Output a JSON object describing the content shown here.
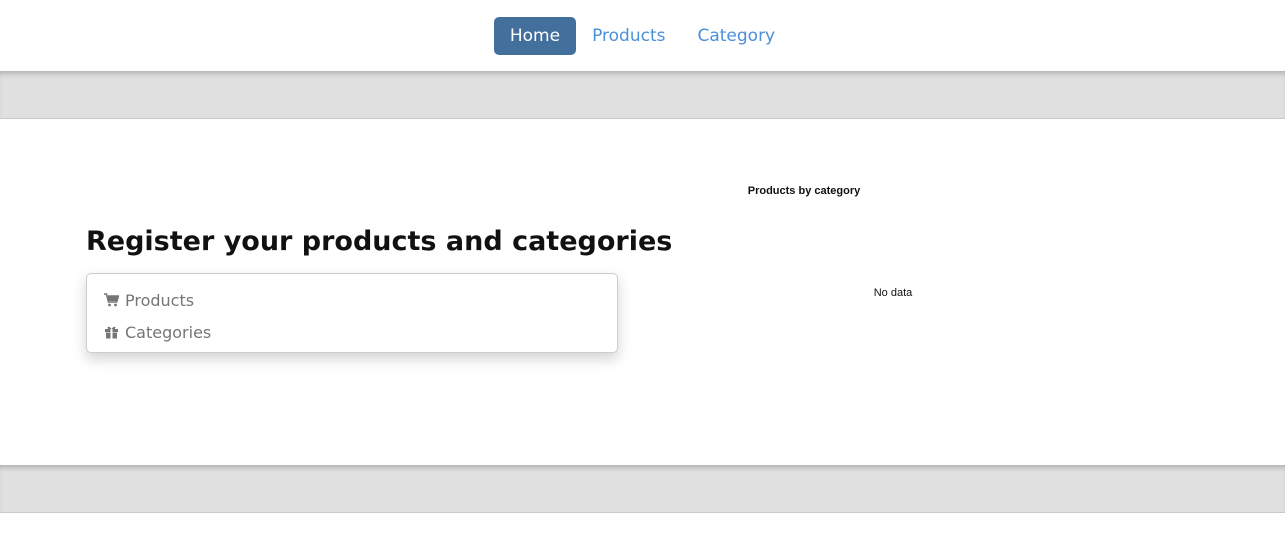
{
  "nav": {
    "items": [
      {
        "label": "Home",
        "active": true
      },
      {
        "label": "Products",
        "active": false
      },
      {
        "label": "Category",
        "active": false
      }
    ]
  },
  "main": {
    "title": "Register your products and categories",
    "menu": [
      {
        "label": "Products",
        "icon": "cart-icon"
      },
      {
        "label": "Categories",
        "icon": "gift-icon"
      }
    ]
  },
  "chart": {
    "title": "Products by category",
    "empty_message": "No data"
  },
  "chart_data": {
    "type": "pie",
    "title": "Products by category",
    "categories": [],
    "values": []
  },
  "colors": {
    "nav_active_bg": "#436f9c",
    "nav_link": "#4a90d9",
    "band": "#e0e0e0",
    "menu_text": "#757575"
  }
}
